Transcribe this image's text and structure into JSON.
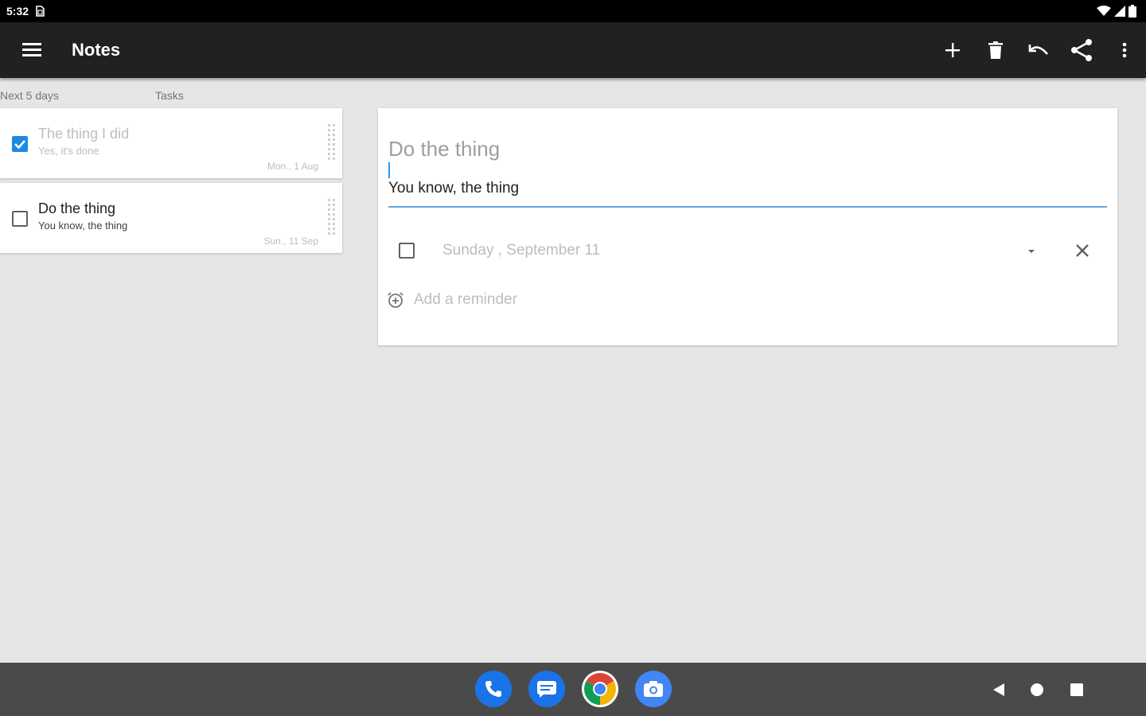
{
  "status_bar": {
    "time": "5:32"
  },
  "app_bar": {
    "title": "Notes"
  },
  "tabs": [
    {
      "label": "Next 5 days"
    },
    {
      "label": "Tasks"
    }
  ],
  "notes": [
    {
      "title": "The thing I did",
      "body": "Yes, it's done",
      "date": "Mon., 1 Aug",
      "checked": true
    },
    {
      "title": "Do the thing",
      "body": "You know, the thing",
      "date": "Sun., 11 Sep",
      "checked": false
    }
  ],
  "editor": {
    "title": "Do the thing",
    "body": "You know, the thing",
    "due_date": "Sunday , September 11",
    "reminder_label": "Add a reminder"
  },
  "colors": {
    "status_bar": "#000000",
    "app_bar": "#212121",
    "background": "#e6e6e6",
    "accent": "#1e88e5",
    "nav_bar": "#4a4a4a"
  }
}
